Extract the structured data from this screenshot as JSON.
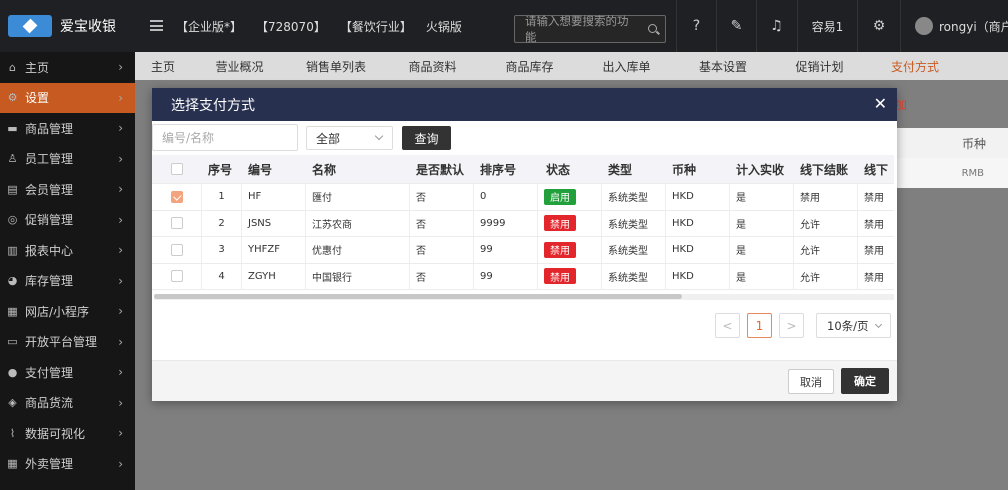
{
  "app": {
    "brand_name": "爱宝收银"
  },
  "topbar": {
    "tags": [
      "【企业版*】",
      "【728070】",
      "【餐饮行业】",
      "火锅版"
    ],
    "search_placeholder": "请输入想要搜索的功能",
    "store_name": "容易1",
    "user_name": "rongyi（商户管"
  },
  "sidebar": {
    "items": [
      {
        "label": "主页",
        "icon": "home-icon"
      },
      {
        "label": "设置",
        "icon": "gear-icon",
        "active": true
      },
      {
        "label": "商品管理",
        "icon": "product-icon"
      },
      {
        "label": "员工管理",
        "icon": "staff-icon"
      },
      {
        "label": "会员管理",
        "icon": "member-icon"
      },
      {
        "label": "促销管理",
        "icon": "promo-icon"
      },
      {
        "label": "报表中心",
        "icon": "report-icon"
      },
      {
        "label": "库存管理",
        "icon": "inventory-icon"
      },
      {
        "label": "网店/小程序",
        "icon": "shop-icon"
      },
      {
        "label": "开放平台管理",
        "icon": "platform-icon"
      },
      {
        "label": "支付管理",
        "icon": "payment-icon"
      },
      {
        "label": "商品货流",
        "icon": "logistics-icon"
      },
      {
        "label": "数据可视化",
        "icon": "chart-icon"
      },
      {
        "label": "外卖管理",
        "icon": "delivery-icon"
      }
    ]
  },
  "tabs": [
    "主页",
    "营业概况",
    "销售单列表",
    "商品资料",
    "商品库存",
    "出入库单",
    "基本设置",
    "促销计划",
    "支付方式"
  ],
  "background": {
    "add_link": "加",
    "column_header": "币种",
    "cell_value": "RMB"
  },
  "modal": {
    "title": "选择支付方式",
    "search_placeholder": "编号/名称",
    "select_value": "全部",
    "query_label": "查询",
    "columns": [
      "序号",
      "编号",
      "名称",
      "是否默认",
      "排序号",
      "状态",
      "类型",
      "币种",
      "计入实收",
      "线下结账",
      "线下"
    ],
    "rows": [
      {
        "checked": true,
        "seq": "1",
        "code": "HF",
        "name": "匯付",
        "default": "否",
        "order": "0",
        "status": "启用",
        "status_color": "#21a03b",
        "type": "系统类型",
        "currency": "HKD",
        "count_actual": "是",
        "offline_checkout": "禁用",
        "offline_other": "禁用"
      },
      {
        "checked": false,
        "seq": "2",
        "code": "JSNS",
        "name": "江苏农商",
        "default": "否",
        "order": "9999",
        "status": "禁用",
        "status_color": "#e2262c",
        "type": "系统类型",
        "currency": "HKD",
        "count_actual": "是",
        "offline_checkout": "允许",
        "offline_other": "禁用"
      },
      {
        "checked": false,
        "seq": "3",
        "code": "YHFZF",
        "name": "优惠付",
        "default": "否",
        "order": "99",
        "status": "禁用",
        "status_color": "#e2262c",
        "type": "系统类型",
        "currency": "HKD",
        "count_actual": "是",
        "offline_checkout": "允许",
        "offline_other": "禁用"
      },
      {
        "checked": false,
        "seq": "4",
        "code": "ZGYH",
        "name": "中国银行",
        "default": "否",
        "order": "99",
        "status": "禁用",
        "status_color": "#e2262c",
        "type": "系统类型",
        "currency": "HKD",
        "count_actual": "是",
        "offline_checkout": "允许",
        "offline_other": "禁用"
      }
    ],
    "pagination": {
      "prev": "<",
      "current": "1",
      "next": ">",
      "page_size": "10条/页"
    },
    "cancel_label": "取消",
    "confirm_label": "确定"
  }
}
